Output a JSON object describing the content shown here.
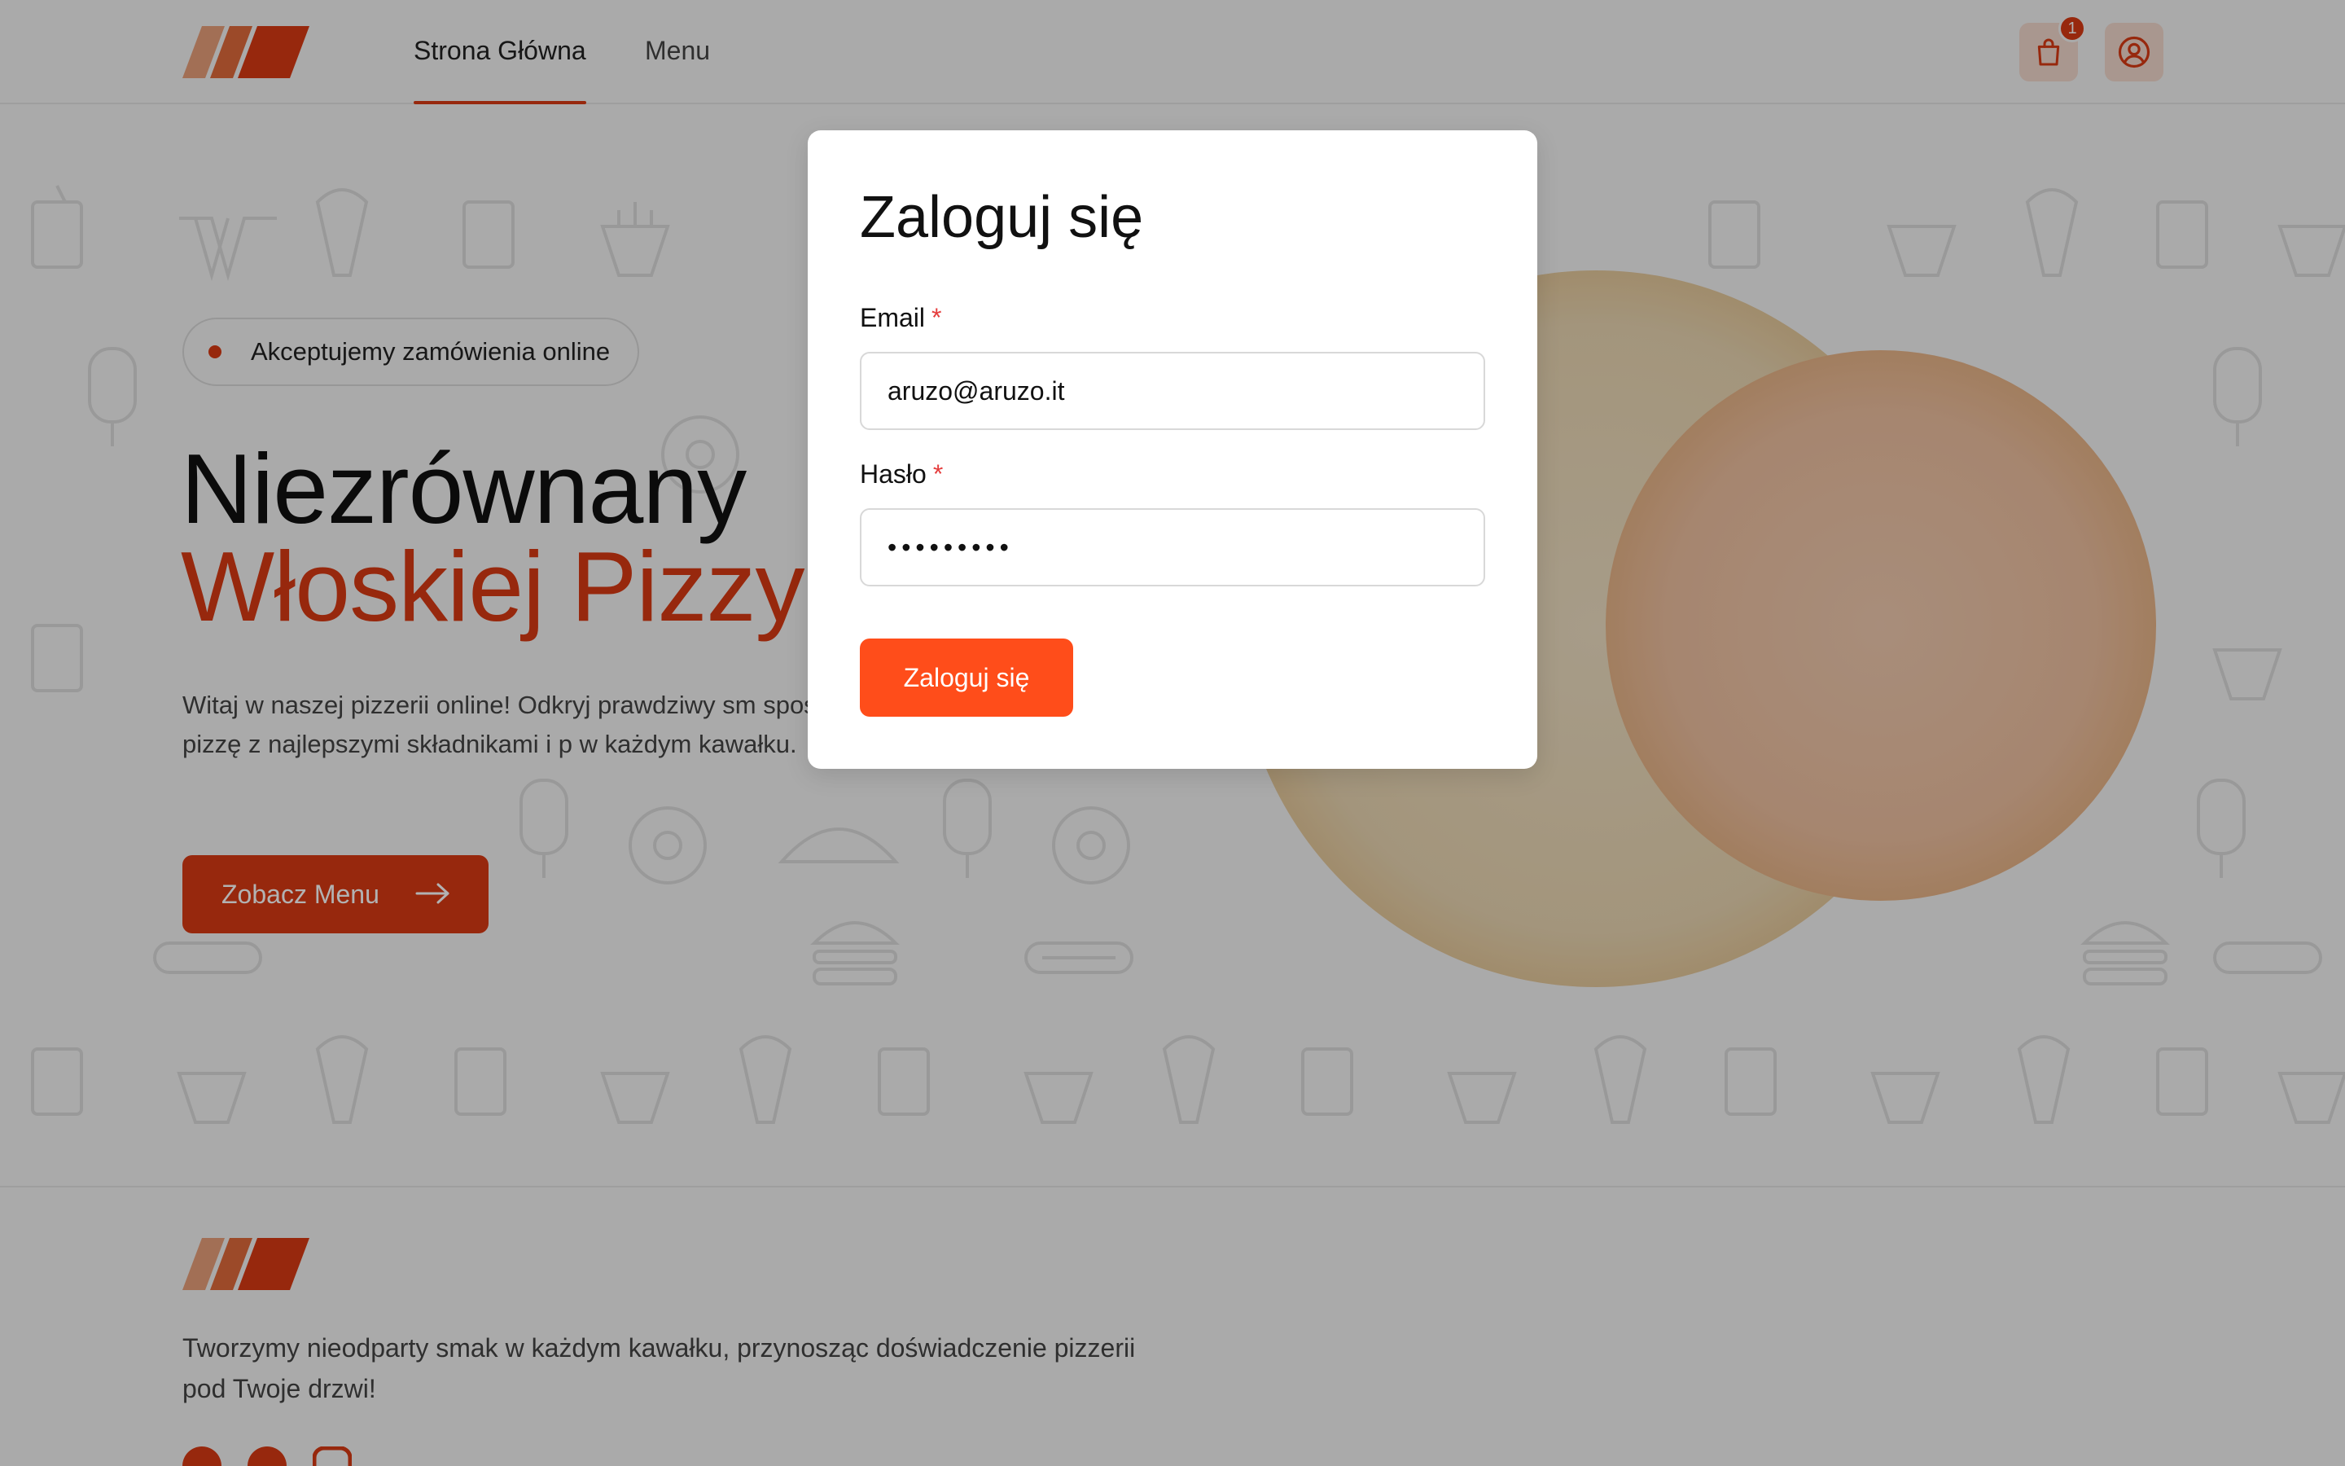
{
  "header": {
    "nav": [
      {
        "label": "Strona Główna"
      },
      {
        "label": "Menu"
      }
    ],
    "cart_count": "1"
  },
  "hero": {
    "badge": "Akceptujemy zamówienia online",
    "title_line1": "Niezrównany",
    "title_line2": "Włoskiej Pizzy",
    "text": "Witaj w naszej pizzerii online! Odkryj prawdziwy sm sposób. Zamów pizzę z najlepszymi składnikami i p w każdym kawałku.",
    "cta_label": "Zobacz Menu"
  },
  "footer": {
    "text": "Tworzymy nieodparty smak w każdym kawałku, przynosząc doświadczenie pizzerii pod Twoje drzwi!",
    "social": [
      "facebook-icon",
      "github-icon",
      "instagram-icon"
    ]
  },
  "login_modal": {
    "title": "Zaloguj się",
    "email_label": "Email",
    "email_value": "aruzo@aruzo.it",
    "password_label": "Hasło",
    "password_value": "•••••••••",
    "required_mark": "*",
    "submit_label": "Zaloguj się"
  },
  "colors": {
    "accent": "#d93a13",
    "button": "#ff4d1a",
    "required": "#e53e3e"
  }
}
